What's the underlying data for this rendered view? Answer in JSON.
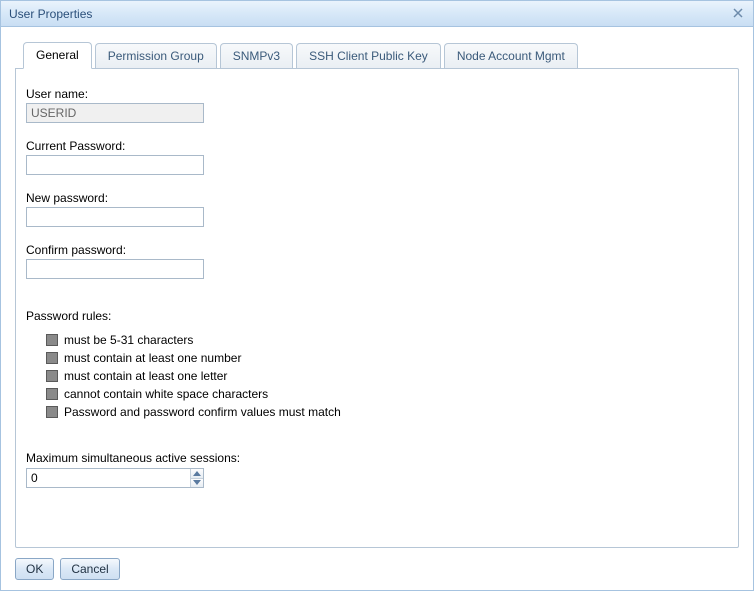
{
  "dialog": {
    "title": "User Properties"
  },
  "tabs": {
    "items": [
      {
        "label": "General",
        "active": true
      },
      {
        "label": "Permission Group",
        "active": false
      },
      {
        "label": "SNMPv3",
        "active": false
      },
      {
        "label": "SSH Client Public Key",
        "active": false
      },
      {
        "label": "Node Account Mgmt",
        "active": false
      }
    ]
  },
  "form": {
    "username_label": "User name:",
    "username_value": "USERID",
    "current_password_label": "Current Password:",
    "current_password_value": "",
    "new_password_label": "New password:",
    "new_password_value": "",
    "confirm_password_label": "Confirm password:",
    "confirm_password_value": "",
    "rules_title": "Password rules:",
    "rules": [
      "must be 5-31 characters",
      "must contain at least one number",
      "must contain at least one letter",
      "cannot contain white space characters",
      "Password and password confirm values must match"
    ],
    "max_sessions_label": "Maximum simultaneous active sessions:",
    "max_sessions_value": "0"
  },
  "buttons": {
    "ok": "OK",
    "cancel": "Cancel"
  }
}
